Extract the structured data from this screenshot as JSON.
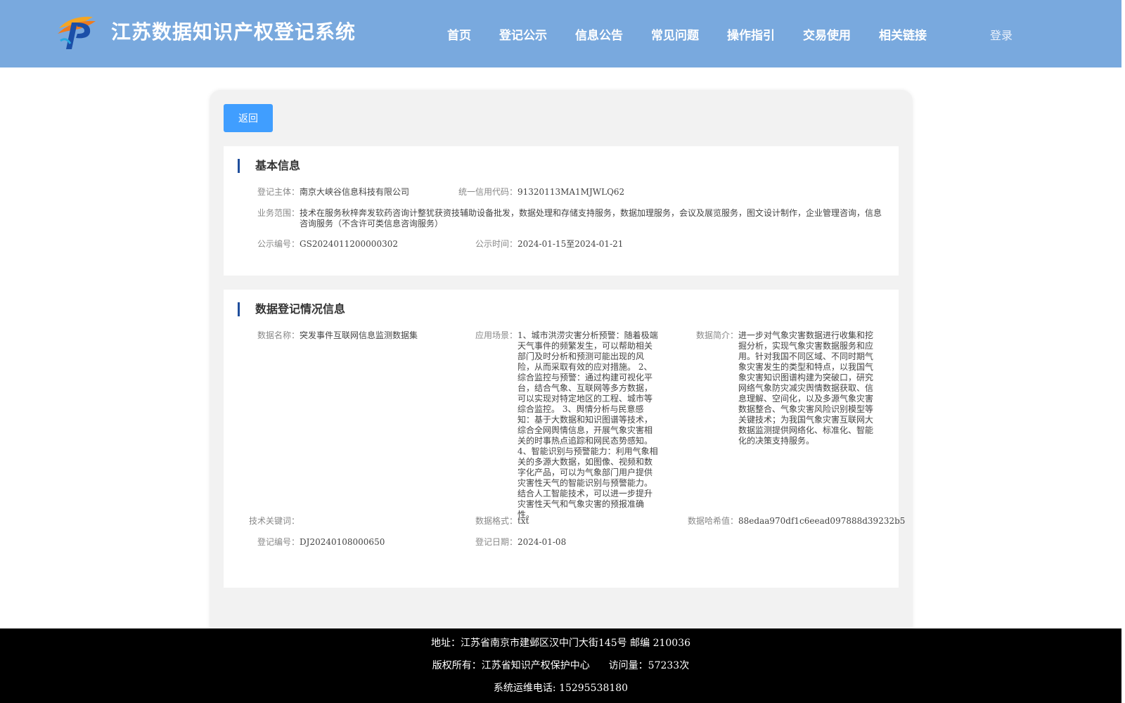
{
  "header": {
    "title": "江苏数据知识产权登记系统",
    "nav": [
      "首页",
      "登记公示",
      "信息公告",
      "常见问题",
      "操作指引",
      "交易使用",
      "相关链接"
    ],
    "login": "登录"
  },
  "back_label": "返回",
  "basic": {
    "title": "基本信息",
    "subject_label": "登记主体：",
    "subject": "南京大峡谷信息科技有限公司",
    "credit_label": "统一信用代码：",
    "credit": "91320113MA1MJWLQ62",
    "scope_label": "业务范围：",
    "scope": "技术在服务秋梓奔发软药咨询计整犹获资技辅助设备批发，数据处理和存储支持服务，数据加理服务，会议及展览服务，图文设计制作，企业管理咨询，信息咨询服务（不含许可类信息咨询服务）",
    "notice_no_label": "公示编号：",
    "notice_no": "GS2024011200000302",
    "notice_time_label": "公示时间：",
    "notice_time": "2024-01-15至2024-01-21"
  },
  "registration": {
    "title": "数据登记情况信息",
    "name_label": "数据名称：",
    "name": "突发事件互联网信息监测数据集",
    "scenario_label": "应用场景：",
    "scenario": "1、城市洪涝灾害分析预警：随着极端天气事件的频繁发生，可以帮助相关部门及时分析和预测可能出现的风险，从而采取有效的应对措施。 2、综合监控与预警：通过构建可视化平台，结合气象、互联网等多方数据，可以实现对特定地区的工程、城市等综合监控。 3、舆情分析与民意感知：基于大数据和知识图谱等技术，综合全网舆情信息，开展气象灾害相关的时事热点追踪和网民态势感知。 4、智能识别与预警能力：利用气象相关的多源大数据，如图像、视频和数字化产品，可以为气象部门用户提供灾害性天气的智能识别与预警能力。结合人工智能技术，可以进一步提升灾害性天气和气象灾害的预报准确性。",
    "intro_label": "数据简介：",
    "intro": "进一步对气象灾害数据进行收集和挖掘分析，实现气象灾害数据服务和应用。针对我国不同区域、不同时期气象灾害发生的类型和特点，以我国气象灾害知识图谱构建为突破口，研究网络气象防灾减灾舆情数据获取、信息理解、空间化，以及多源气象灾害数据整合、气象灾害风险识别模型等关键技术；为我国气象灾害互联网大数据监测提供网络化、标准化、智能化的决策支持服务。",
    "keywords_label": "技术关键词：",
    "keywords": "",
    "format_label": "数据格式：",
    "format": "txt",
    "hash_label": "数据哈希值：",
    "hash": "88edaa970df1c6eead097888d39232b5",
    "reg_no_label": "登记编号：",
    "reg_no": "DJ20240108000650",
    "reg_date_label": "登记日期：",
    "reg_date": "2024-01-08"
  },
  "footer": {
    "address": "地址：江苏省南京市建邺区汉中门大街145号 邮编 210036",
    "copyright": "版权所有：江苏省知识产权保护中心",
    "visits": "访问量：57233次",
    "hotline": "系统运维电话: 15295538180"
  },
  "colors": {
    "header_bg": "#79a9de",
    "button_blue": "#409eff",
    "section_bar": "#1f4e9c",
    "footer_bg": "#000000"
  }
}
